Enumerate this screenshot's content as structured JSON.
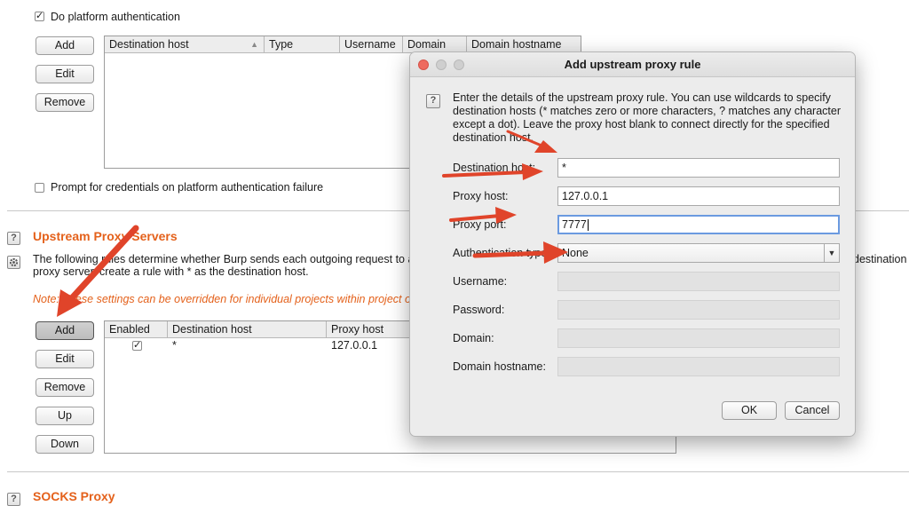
{
  "platform_auth": {
    "checkbox_label": "Do platform authentication",
    "checked": true,
    "buttons": {
      "add": "Add",
      "edit": "Edit",
      "remove": "Remove"
    },
    "columns": [
      "Destination host",
      "Type",
      "Username",
      "Domain",
      "Domain hostname"
    ],
    "prompt_label": "Prompt for credentials on platform authentication failure"
  },
  "upstream": {
    "title": "Upstream Proxy Servers",
    "desc_line1": "The following rules determine whether Burp sends each outgoing request to a",
    "desc_line2": "proxy server, create a rule with * as the destination host.",
    "desc_right": "destination ho",
    "note": "Note: These settings can be overridden for individual projects within project o",
    "buttons": {
      "add": "Add",
      "edit": "Edit",
      "remove": "Remove",
      "up": "Up",
      "down": "Down"
    },
    "columns": [
      "Enabled",
      "Destination host",
      "Proxy host"
    ],
    "rows": [
      {
        "enabled": true,
        "destination_host": "*",
        "proxy_host": "127.0.0.1"
      }
    ]
  },
  "socks": {
    "title": "SOCKS Proxy"
  },
  "dialog": {
    "title": "Add upstream proxy rule",
    "description": "Enter the details of the upstream proxy rule. You can use wildcards to specify destination hosts (* matches zero or more characters, ? matches any character except a dot). Leave the proxy host blank to connect directly for the specified destination host.",
    "labels": {
      "destination_host": "Destination host:",
      "proxy_host": "Proxy host:",
      "proxy_port": "Proxy port:",
      "authentication": "Authentication type:",
      "username": "Username:",
      "password": "Password:",
      "domain": "Domain:",
      "domain_hostname": "Domain hostname:"
    },
    "values": {
      "destination_host": "*",
      "proxy_host": "127.0.0.1",
      "proxy_port": "7777",
      "authentication": "None",
      "username": "",
      "password": "",
      "domain": "",
      "domain_hostname": ""
    },
    "ok_label": "OK",
    "cancel_label": "Cancel"
  },
  "colors": {
    "accent_orange": "#e4611b",
    "annotation_red": "#e0442a",
    "focus_blue": "#6b9ae0"
  },
  "icons": [
    "help-icon",
    "gear-icon",
    "dropdown-arrow-icon",
    "annotation-arrow"
  ]
}
